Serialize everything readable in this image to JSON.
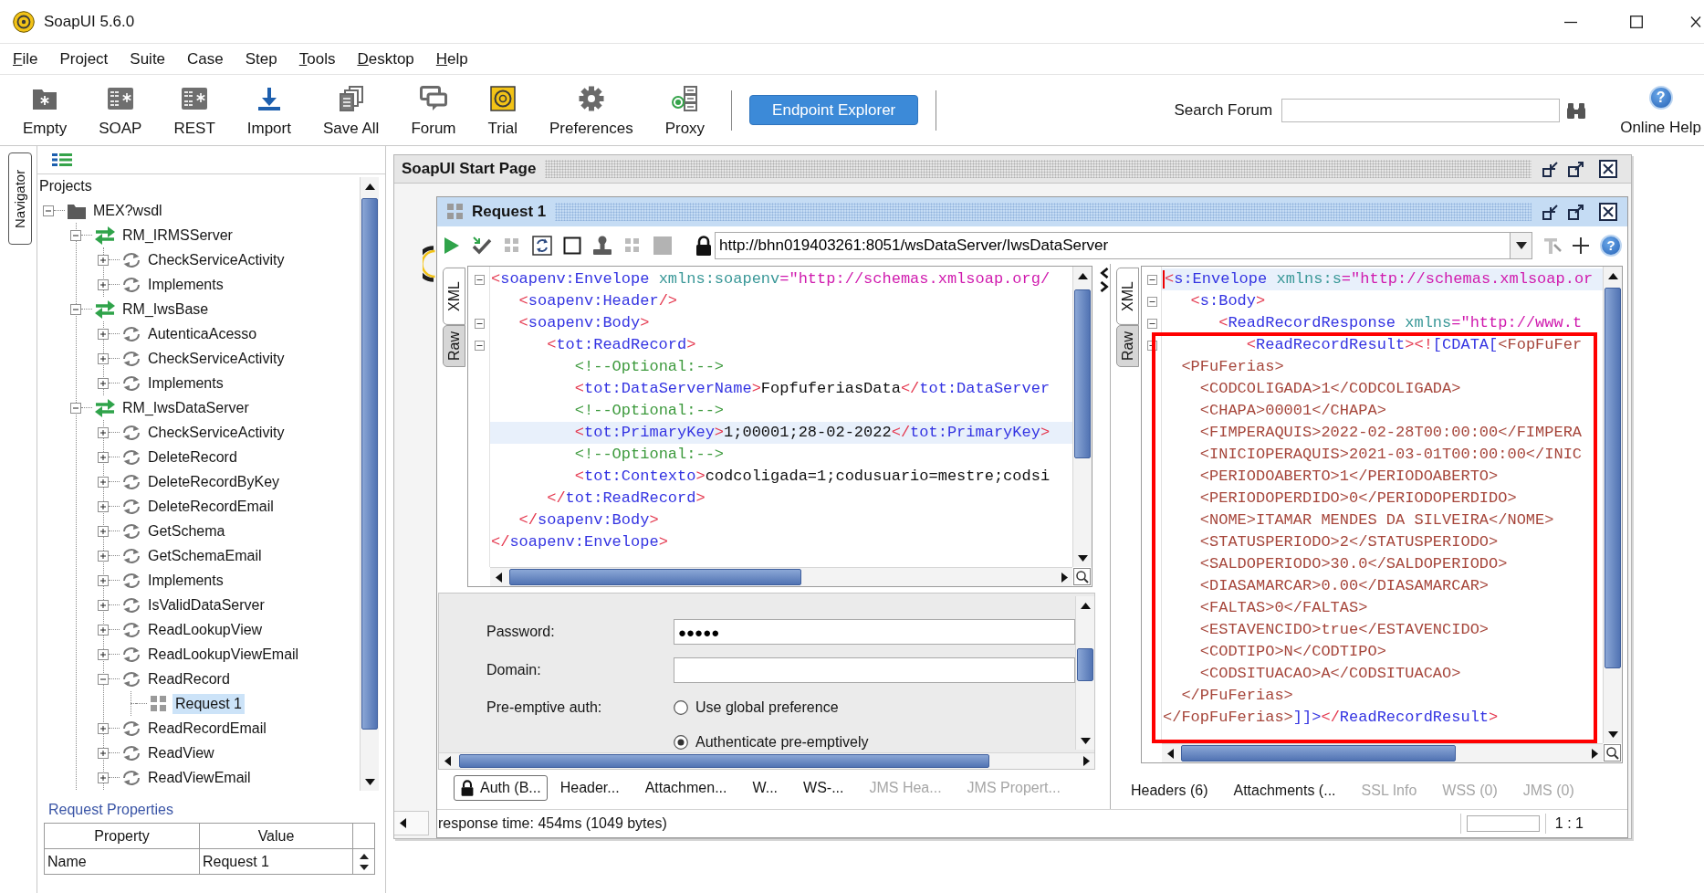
{
  "window": {
    "title": "SoapUI 5.6.0"
  },
  "menu": [
    {
      "label": "File",
      "mnemonic": true
    },
    {
      "label": "Project",
      "mnemonic": false
    },
    {
      "label": "Suite",
      "mnemonic": false
    },
    {
      "label": "Case",
      "mnemonic": false
    },
    {
      "label": "Step",
      "mnemonic": false
    },
    {
      "label": "Tools",
      "mnemonic": true
    },
    {
      "label": "Desktop",
      "mnemonic": true
    },
    {
      "label": "Help",
      "mnemonic": true
    }
  ],
  "toolbar": {
    "buttons": [
      {
        "kind": "empty",
        "label": "Empty"
      },
      {
        "kind": "soap",
        "label": "SOAP"
      },
      {
        "kind": "rest",
        "label": "REST"
      },
      {
        "kind": "import",
        "label": "Import"
      },
      {
        "kind": "save_all",
        "label": "Save All"
      },
      {
        "kind": "forum",
        "label": "Forum"
      },
      {
        "kind": "trial",
        "label": "Trial"
      },
      {
        "kind": "preferences",
        "label": "Preferences"
      },
      {
        "kind": "proxy",
        "label": "Proxy"
      }
    ],
    "endpoint_button": "Endpoint Explorer",
    "search_label": "Search Forum",
    "help": {
      "icon": "?",
      "label": "Online Help"
    }
  },
  "navigator": {
    "tab": "Navigator",
    "heading": "Projects",
    "tree": [
      {
        "label": "MEX?wsdl",
        "kind": "project",
        "expanded": true,
        "selected": false,
        "children": [
          {
            "label": "RM_IRMSServer",
            "kind": "interface",
            "expanded": true,
            "selected": false,
            "children": [
              {
                "label": "CheckServiceActivity",
                "kind": "operation",
                "expanded": false,
                "selected": false
              },
              {
                "label": "Implements",
                "kind": "operation",
                "expanded": false,
                "selected": false
              }
            ]
          },
          {
            "label": "RM_IwsBase",
            "kind": "interface",
            "expanded": true,
            "selected": false,
            "children": [
              {
                "label": "AutenticaAcesso",
                "kind": "operation",
                "expanded": false,
                "selected": false
              },
              {
                "label": "CheckServiceActivity",
                "kind": "operation",
                "expanded": false,
                "selected": false
              },
              {
                "label": "Implements",
                "kind": "operation",
                "expanded": false,
                "selected": false
              }
            ]
          },
          {
            "label": "RM_IwsDataServer",
            "kind": "interface",
            "expanded": true,
            "selected": false,
            "children": [
              {
                "label": "CheckServiceActivity",
                "kind": "operation",
                "expanded": false,
                "selected": false
              },
              {
                "label": "DeleteRecord",
                "kind": "operation",
                "expanded": false,
                "selected": false
              },
              {
                "label": "DeleteRecordByKey",
                "kind": "operation",
                "expanded": false,
                "selected": false
              },
              {
                "label": "DeleteRecordEmail",
                "kind": "operation",
                "expanded": false,
                "selected": false
              },
              {
                "label": "GetSchema",
                "kind": "operation",
                "expanded": false,
                "selected": false
              },
              {
                "label": "GetSchemaEmail",
                "kind": "operation",
                "expanded": false,
                "selected": false
              },
              {
                "label": "Implements",
                "kind": "operation",
                "expanded": false,
                "selected": false
              },
              {
                "label": "IsValidDataServer",
                "kind": "operation",
                "expanded": false,
                "selected": false
              },
              {
                "label": "ReadLookupView",
                "kind": "operation",
                "expanded": false,
                "selected": false
              },
              {
                "label": "ReadLookupViewEmail",
                "kind": "operation",
                "expanded": false,
                "selected": false
              },
              {
                "label": "ReadRecord",
                "kind": "operation",
                "expanded": true,
                "selected": false,
                "children": [
                  {
                    "label": "Request 1",
                    "kind": "request",
                    "selected": true
                  }
                ]
              },
              {
                "label": "ReadRecordEmail",
                "kind": "operation",
                "expanded": false,
                "selected": false
              },
              {
                "label": "ReadView",
                "kind": "operation",
                "expanded": false,
                "selected": false
              },
              {
                "label": "ReadViewEmail",
                "kind": "operation",
                "expanded": false,
                "selected": false
              }
            ]
          }
        ]
      }
    ],
    "properties": {
      "title": "Request Properties",
      "columns": [
        "Property",
        "Value"
      ],
      "rows": [
        [
          "Name",
          "Request 1"
        ]
      ]
    }
  },
  "start_page": {
    "title": "SoapUI Start Page"
  },
  "request": {
    "title": "Request 1",
    "url": "http://bhn019403261:8051/wsDataServer/IwsDataServer",
    "help_icon": "?",
    "editor": {
      "focused": false,
      "view_tabs": [
        {
          "label": "XML",
          "selected": true
        },
        {
          "label": "Raw",
          "selected": false
        }
      ],
      "lines": [
        {
          "fold": true,
          "current": false,
          "tokens": [
            {
              "kind": "bracket",
              "text": "<"
            },
            {
              "kind": "tag",
              "text": "soapenv:Envelope"
            },
            {
              "kind": "attr",
              "text": " xmlns:soapenv"
            },
            {
              "kind": "value",
              "text": "=\"http://schemas.xmlsoap.org/"
            }
          ]
        },
        {
          "fold": false,
          "current": false,
          "tokens": [
            {
              "kind": "bracket",
              "text": "   <"
            },
            {
              "kind": "tag",
              "text": "soapenv:Header"
            },
            {
              "kind": "bracket",
              "text": "/>"
            }
          ]
        },
        {
          "fold": true,
          "current": false,
          "tokens": [
            {
              "kind": "bracket",
              "text": "   <"
            },
            {
              "kind": "tag",
              "text": "soapenv:Body"
            },
            {
              "kind": "bracket",
              "text": ">"
            }
          ]
        },
        {
          "fold": true,
          "current": false,
          "tokens": [
            {
              "kind": "bracket",
              "text": "      <"
            },
            {
              "kind": "tag",
              "text": "tot:ReadRecord"
            },
            {
              "kind": "bracket",
              "text": ">"
            }
          ]
        },
        {
          "fold": false,
          "current": false,
          "tokens": [
            {
              "kind": "comment",
              "text": "         <!--Optional:-->"
            }
          ]
        },
        {
          "fold": false,
          "current": false,
          "tokens": [
            {
              "kind": "bracket",
              "text": "         <"
            },
            {
              "kind": "tag",
              "text": "tot:DataServerName"
            },
            {
              "kind": "bracket",
              "text": ">"
            },
            {
              "kind": "text",
              "text": "FopfuferiasData"
            },
            {
              "kind": "bracket",
              "text": "</"
            },
            {
              "kind": "tag",
              "text": "tot:DataServer"
            }
          ]
        },
        {
          "fold": false,
          "current": false,
          "tokens": [
            {
              "kind": "comment",
              "text": "         <!--Optional:-->"
            }
          ]
        },
        {
          "fold": false,
          "current": true,
          "tokens": [
            {
              "kind": "bracket",
              "text": "         <"
            },
            {
              "kind": "tag",
              "text": "tot:PrimaryKey"
            },
            {
              "kind": "bracket",
              "text": ">"
            },
            {
              "kind": "text",
              "text": "1;00001;28-02-2022"
            },
            {
              "kind": "bracket",
              "text": "</"
            },
            {
              "kind": "tag",
              "text": "tot:PrimaryKey"
            },
            {
              "kind": "bracket",
              "text": ">"
            }
          ]
        },
        {
          "fold": false,
          "current": false,
          "tokens": [
            {
              "kind": "comment",
              "text": "         <!--Optional:-->"
            }
          ]
        },
        {
          "fold": false,
          "current": false,
          "tokens": [
            {
              "kind": "bracket",
              "text": "         <"
            },
            {
              "kind": "tag",
              "text": "tot:Contexto"
            },
            {
              "kind": "bracket",
              "text": ">"
            },
            {
              "kind": "text",
              "text": "codcoligada=1;codusuario=mestre;codsi"
            }
          ]
        },
        {
          "fold": false,
          "current": false,
          "tokens": [
            {
              "kind": "bracket",
              "text": "      </"
            },
            {
              "kind": "tag",
              "text": "tot:ReadRecord"
            },
            {
              "kind": "bracket",
              "text": ">"
            }
          ]
        },
        {
          "fold": false,
          "current": false,
          "tokens": [
            {
              "kind": "bracket",
              "text": "   </"
            },
            {
              "kind": "tag",
              "text": "soapenv:Body"
            },
            {
              "kind": "bracket",
              "text": ">"
            }
          ]
        },
        {
          "fold": false,
          "current": false,
          "tokens": [
            {
              "kind": "bracket",
              "text": "</"
            },
            {
              "kind": "tag",
              "text": "soapenv:Envelope"
            },
            {
              "kind": "bracket",
              "text": ">"
            }
          ]
        }
      ]
    },
    "auth": {
      "fields": [
        {
          "label": "Password:",
          "value": "●●●●●"
        },
        {
          "label": "Domain:"
        }
      ],
      "preemptive": {
        "label": "Pre-emptive auth:",
        "options": [
          {
            "label": "Use global preference",
            "selected": false
          },
          {
            "label": "Authenticate pre-emptively",
            "selected": true
          }
        ]
      }
    },
    "tabs": [
      {
        "kind": "auth",
        "label": "Auth (B...",
        "selected": true,
        "disabled": false
      },
      {
        "kind": "plain",
        "label": "Header...",
        "selected": false,
        "disabled": false
      },
      {
        "kind": "plain",
        "label": "Attachmen...",
        "selected": false,
        "disabled": false
      },
      {
        "kind": "plain",
        "label": "W...",
        "selected": false,
        "disabled": false
      },
      {
        "kind": "plain",
        "label": "WS-...",
        "selected": false,
        "disabled": false
      },
      {
        "kind": "plain",
        "label": "JMS Hea...",
        "selected": false,
        "disabled": true
      },
      {
        "kind": "plain",
        "label": "JMS Propert...",
        "selected": false,
        "disabled": true
      }
    ]
  },
  "response": {
    "editor": {
      "focused": true,
      "view_tabs": [
        {
          "label": "XML",
          "selected": true
        },
        {
          "label": "Raw",
          "selected": false
        }
      ],
      "lines": [
        {
          "fold": true,
          "current": true,
          "tokens": [
            {
              "kind": "bracket",
              "text": "<"
            },
            {
              "kind": "tag",
              "text": "s:Envelope"
            },
            {
              "kind": "attr",
              "text": " xmlns:s"
            },
            {
              "kind": "value",
              "text": "=\"http://schemas.xmlsoap.or"
            }
          ]
        },
        {
          "fold": true,
          "current": false,
          "tokens": [
            {
              "kind": "bracket",
              "text": "   <"
            },
            {
              "kind": "tag",
              "text": "s:Body"
            },
            {
              "kind": "bracket",
              "text": ">"
            }
          ]
        },
        {
          "fold": true,
          "current": false,
          "tokens": [
            {
              "kind": "bracket",
              "text": "      <"
            },
            {
              "kind": "tag",
              "text": "ReadRecordResponse"
            },
            {
              "kind": "attr",
              "text": " xmlns"
            },
            {
              "kind": "value",
              "text": "=\"http://www.t"
            }
          ]
        },
        {
          "fold": true,
          "current": false,
          "tokens": [
            {
              "kind": "bracket",
              "text": "         <"
            },
            {
              "kind": "tag",
              "text": "ReadRecordResult"
            },
            {
              "kind": "bracket",
              "text": ">"
            },
            {
              "kind": "bracket",
              "text": "<!"
            },
            {
              "kind": "tag",
              "text": "[CDATA["
            },
            {
              "kind": "cdata",
              "text": "<FopFuFer"
            }
          ]
        },
        {
          "fold": false,
          "current": false,
          "tokens": [
            {
              "kind": "cdata",
              "text": "  <PFuFerias>"
            }
          ]
        },
        {
          "fold": false,
          "current": false,
          "tokens": [
            {
              "kind": "cdata",
              "text": "    <CODCOLIGADA>1</CODCOLIGADA>"
            }
          ]
        },
        {
          "fold": false,
          "current": false,
          "tokens": [
            {
              "kind": "cdata",
              "text": "    <CHAPA>00001</CHAPA>"
            }
          ]
        },
        {
          "fold": false,
          "current": false,
          "tokens": [
            {
              "kind": "cdata",
              "text": "    <FIMPERAQUIS>2022-02-28T00:00:00</FIMPERA"
            }
          ]
        },
        {
          "fold": false,
          "current": false,
          "tokens": [
            {
              "kind": "cdata",
              "text": "    <INICIOPERAQUIS>2021-03-01T00:00:00</INIC"
            }
          ]
        },
        {
          "fold": false,
          "current": false,
          "tokens": [
            {
              "kind": "cdata",
              "text": "    <PERIODOABERTO>1</PERIODOABERTO>"
            }
          ]
        },
        {
          "fold": false,
          "current": false,
          "tokens": [
            {
              "kind": "cdata",
              "text": "    <PERIODOPERDIDO>0</PERIODOPERDIDO>"
            }
          ]
        },
        {
          "fold": false,
          "current": false,
          "tokens": [
            {
              "kind": "cdata",
              "text": "    <NOME>ITAMAR MENDES DA SILVEIRA</NOME>"
            }
          ]
        },
        {
          "fold": false,
          "current": false,
          "tokens": [
            {
              "kind": "cdata",
              "text": "    <STATUSPERIODO>2</STATUSPERIODO>"
            }
          ]
        },
        {
          "fold": false,
          "current": false,
          "tokens": [
            {
              "kind": "cdata",
              "text": "    <SALDOPERIODO>30.0</SALDOPERIODO>"
            }
          ]
        },
        {
          "fold": false,
          "current": false,
          "tokens": [
            {
              "kind": "cdata",
              "text": "    <DIASAMARCAR>0.00</DIASAMARCAR>"
            }
          ]
        },
        {
          "fold": false,
          "current": false,
          "tokens": [
            {
              "kind": "cdata",
              "text": "    <FALTAS>0</FALTAS>"
            }
          ]
        },
        {
          "fold": false,
          "current": false,
          "tokens": [
            {
              "kind": "cdata",
              "text": "    <ESTAVENCIDO>true</ESTAVENCIDO>"
            }
          ]
        },
        {
          "fold": false,
          "current": false,
          "tokens": [
            {
              "kind": "cdata",
              "text": "    <CODTIPO>N</CODTIPO>"
            }
          ]
        },
        {
          "fold": false,
          "current": false,
          "tokens": [
            {
              "kind": "cdata",
              "text": "    <CODSITUACAO>A</CODSITUACAO>"
            }
          ]
        },
        {
          "fold": false,
          "current": false,
          "tokens": [
            {
              "kind": "cdata",
              "text": "  </PFuFerias>"
            }
          ]
        },
        {
          "fold": false,
          "current": false,
          "tokens": [
            {
              "kind": "cdata",
              "text": "</FopFuFerias>"
            },
            {
              "kind": "tag",
              "text": "]]>"
            },
            {
              "kind": "bracket",
              "text": "</"
            },
            {
              "kind": "tag",
              "text": "ReadRecordResult"
            },
            {
              "kind": "bracket",
              "text": ">"
            }
          ]
        }
      ]
    },
    "tabs": [
      {
        "kind": "plain",
        "label": "Headers (6)",
        "selected": false,
        "disabled": false
      },
      {
        "kind": "plain",
        "label": "Attachments (...",
        "selected": false,
        "disabled": false
      },
      {
        "kind": "plain",
        "label": "SSL Info",
        "selected": false,
        "disabled": true
      },
      {
        "kind": "plain",
        "label": "WSS (0)",
        "selected": false,
        "disabled": true
      },
      {
        "kind": "plain",
        "label": "JMS (0)",
        "selected": false,
        "disabled": true
      }
    ]
  },
  "status_bar": {
    "text": "response time: 454ms (1049 bytes)",
    "position": "1 : 1"
  }
}
